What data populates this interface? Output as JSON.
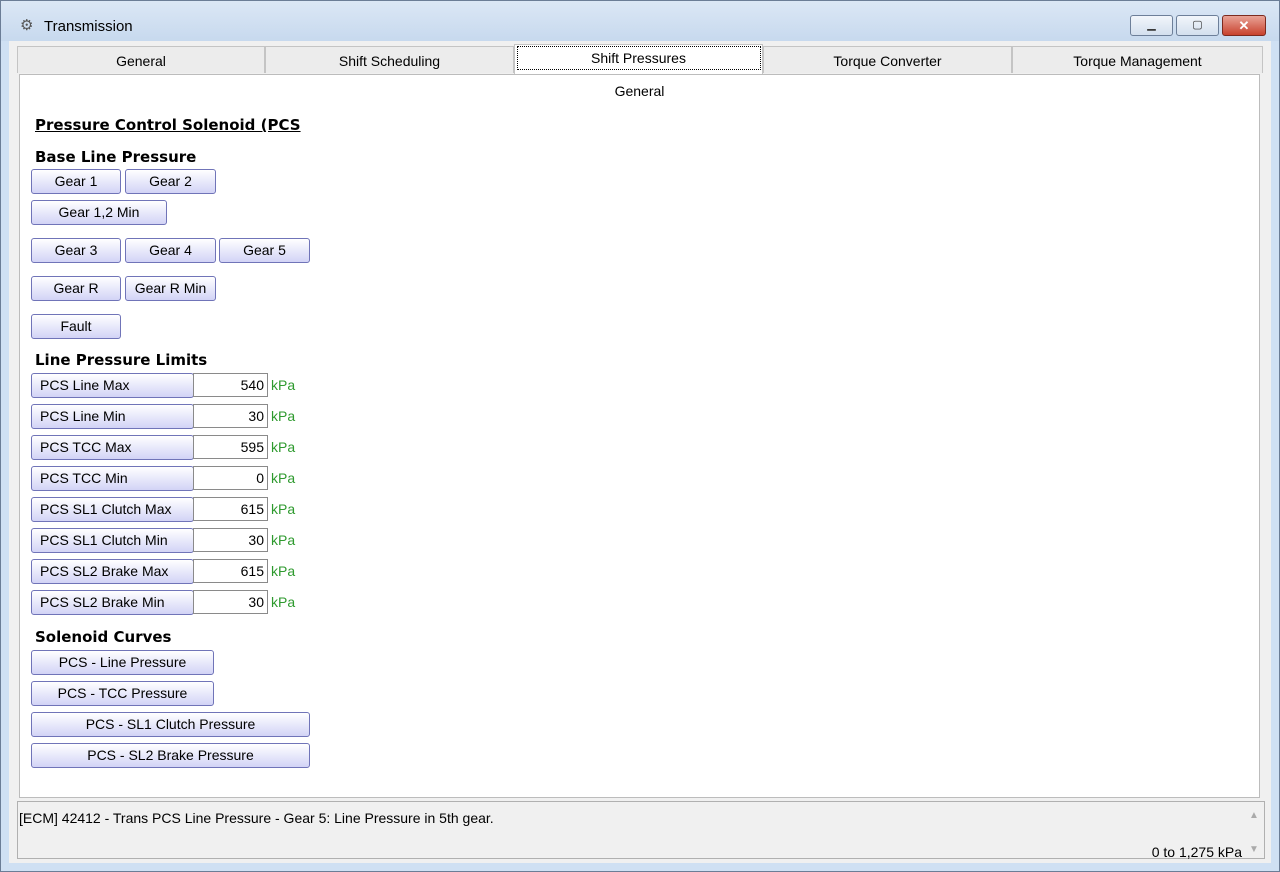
{
  "window": {
    "title": "Transmission",
    "icon": "gear-icon"
  },
  "tabs": [
    {
      "label": "General"
    },
    {
      "label": "Shift Scheduling"
    },
    {
      "label": "Shift Pressures"
    },
    {
      "label": "Torque Converter"
    },
    {
      "label": "Torque Management"
    }
  ],
  "panel": {
    "sub_label": "General",
    "heading": "Pressure Control Solenoid (PCS",
    "base_line": {
      "title": "Base Line Pressure",
      "buttons": [
        "Gear 1",
        "Gear 2",
        "Gear 1,2 Min",
        "Gear 3",
        "Gear 4",
        "Gear 5",
        "Gear R",
        "Gear R Min",
        "Fault"
      ]
    },
    "limits": {
      "title": "Line Pressure Limits",
      "rows": [
        {
          "label": "PCS Line Max",
          "value": "540",
          "unit": "kPa"
        },
        {
          "label": "PCS Line Min",
          "value": "30",
          "unit": "kPa"
        },
        {
          "label": "PCS TCC Max",
          "value": "595",
          "unit": "kPa"
        },
        {
          "label": "PCS TCC Min",
          "value": "0",
          "unit": "kPa"
        },
        {
          "label": "PCS SL1 Clutch Max",
          "value": "615",
          "unit": "kPa"
        },
        {
          "label": "PCS SL1 Clutch Min",
          "value": "30",
          "unit": "kPa"
        },
        {
          "label": "PCS SL2 Brake Max",
          "value": "615",
          "unit": "kPa"
        },
        {
          "label": "PCS SL2 Brake Min",
          "value": "30",
          "unit": "kPa"
        }
      ]
    },
    "curves": {
      "title": "Solenoid Curves",
      "buttons": [
        "PCS - Line Pressure",
        "PCS - TCC Pressure",
        "PCS - SL1 Clutch Pressure",
        "PCS - SL2 Brake Pressure"
      ]
    }
  },
  "status": {
    "description": "[ECM] 42412 - Trans PCS Line Pressure - Gear 5: Line Pressure in 5th gear.",
    "range": "0 to 1,275 kPa"
  },
  "colors": {
    "unit_text": "#2e9a2e",
    "button_border": "#7074b8"
  }
}
